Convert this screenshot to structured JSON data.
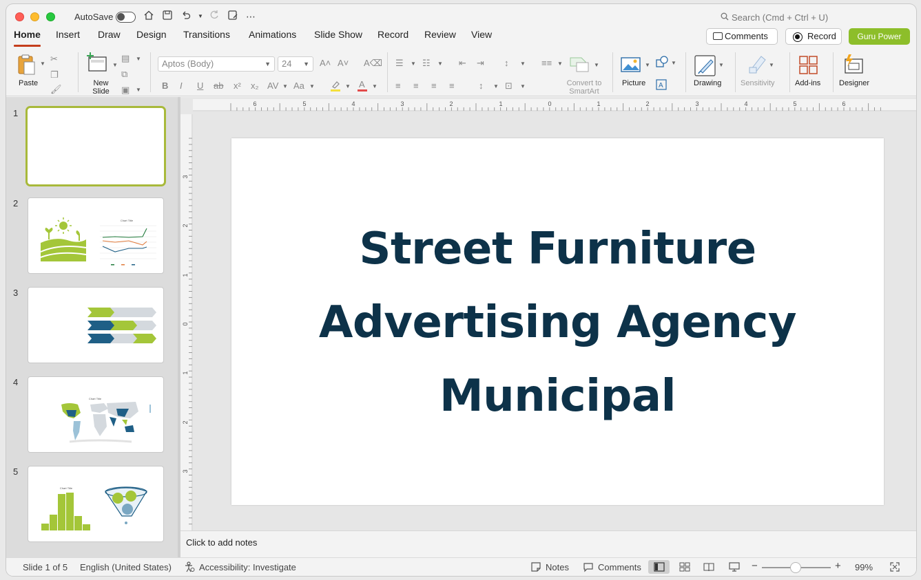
{
  "titlebar": {
    "autosave_label": "AutoSave",
    "search_placeholder": "Search (Cmd + Ctrl + U)"
  },
  "tabs": [
    {
      "label": "Home",
      "active": true
    },
    {
      "label": "Insert"
    },
    {
      "label": "Draw"
    },
    {
      "label": "Design"
    },
    {
      "label": "Transitions"
    },
    {
      "label": "Animations"
    },
    {
      "label": "Slide Show"
    },
    {
      "label": "Record"
    },
    {
      "label": "Review"
    },
    {
      "label": "View"
    }
  ],
  "header_buttons": {
    "comments": "Comments",
    "record": "Record",
    "guru": "Guru Power"
  },
  "ribbon": {
    "paste": "Paste",
    "new_slide": "New Slide",
    "font_name": "Aptos (Body)",
    "font_size": "24",
    "convert_smartart": "Convert to SmartArt",
    "picture": "Picture",
    "drawing": "Drawing",
    "sensitivity": "Sensitivity",
    "addins": "Add-ins",
    "designer": "Designer"
  },
  "thumbnails": [
    {
      "number": "1",
      "selected": true
    },
    {
      "number": "2"
    },
    {
      "number": "3"
    },
    {
      "number": "4",
      "chart_title": "Chart Title"
    },
    {
      "number": "5",
      "chart_title": "Chart Title"
    }
  ],
  "thumb2_chart": {
    "title": "Chart Title"
  },
  "ruler": {
    "h_labels": [
      "6",
      "5",
      "4",
      "3",
      "2",
      "1",
      "0",
      "1",
      "2",
      "3",
      "4",
      "5",
      "6"
    ],
    "v_labels": [
      "3",
      "2",
      "1",
      "0",
      "1",
      "2",
      "3"
    ]
  },
  "slide": {
    "title_lines": [
      "Street Furniture",
      "Advertising Agency",
      "Municipal"
    ]
  },
  "notes": {
    "placeholder": "Click to add notes"
  },
  "statusbar": {
    "slide_info": "Slide 1 of 5",
    "language": "English (United States)",
    "accessibility": "Accessibility: Investigate",
    "notes": "Notes",
    "comments": "Comments",
    "zoom": "99%"
  },
  "colors": {
    "accent_tab": "#c43e1c",
    "guru_green": "#8dbe2a",
    "title_navy": "#0d3249",
    "thumb_green": "#a4c639",
    "thumb_blue": "#1f5f86"
  }
}
